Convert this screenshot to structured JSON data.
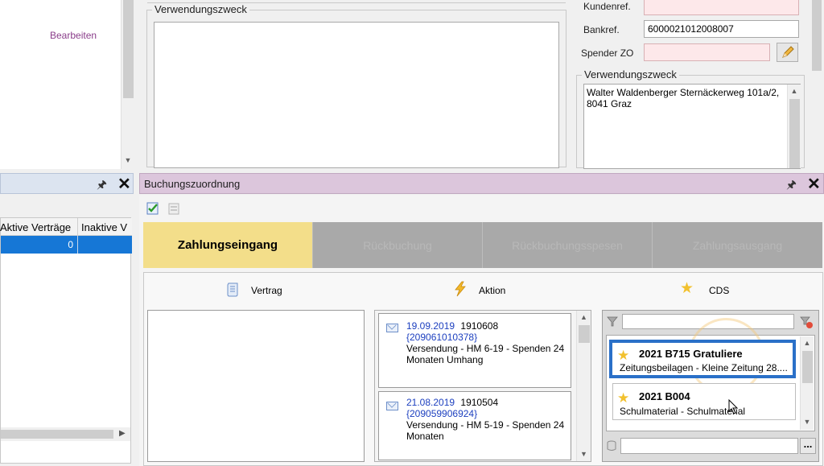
{
  "left_top": {
    "edit_link": "Bearbeiten"
  },
  "center_top": {
    "purpose_legend": "Verwendungszweck"
  },
  "right_top": {
    "customer_ref_label": "Kundenref.",
    "customer_ref_value": "",
    "bank_ref_label": "Bankref.",
    "bank_ref_value": "6000021012008007",
    "donor_label": "Spender ZO",
    "donor_value": "",
    "purpose_legend": "Verwendungszweck",
    "purpose_text_line1": "Walter Waldenberger Sternäckerweg 101a/2,",
    "purpose_text_line2": "8041 Graz"
  },
  "left_panel": {
    "columns": [
      "Aktive Verträge",
      "Inaktive V"
    ],
    "row_value": "0"
  },
  "booking_panel": {
    "title": "Buchungszuordnung",
    "tabs": [
      {
        "label": "Zahlungseingang",
        "active": true
      },
      {
        "label": "Rückbuchung",
        "active": false
      },
      {
        "label": "Rückbuchungsspesen",
        "active": false
      },
      {
        "label": "Zahlungsausgang",
        "active": false
      }
    ],
    "headers": {
      "contract": "Vertrag",
      "action": "Aktion",
      "cds": "CDS"
    },
    "actions": [
      {
        "date": "19.09.2019",
        "number": "1910608",
        "ref": "{209061010378}",
        "line1": "Versendung - HM 6-19 - Spenden 24",
        "line2": "Monaten Umhang"
      },
      {
        "date": "21.08.2019",
        "number": "1910504",
        "ref": "{209059906924}",
        "line1": "Versendung - HM 5-19 - Spenden 24",
        "line2": "Monaten"
      }
    ],
    "cds_items": [
      {
        "title": "2021 B715 Gratuliere",
        "subtitle": "Zeitungsbeilagen - Kleine Zeitung 28....",
        "selected": true
      },
      {
        "title": "2021 B004",
        "subtitle": "Schulmaterial - Schulmaterial",
        "selected": false
      }
    ],
    "cds_more_button": "..."
  },
  "colors": {
    "title_bar_pink": "#dcc6dc",
    "active_tab": "#f3de8a",
    "inactive_tab": "#a9a9a9",
    "selection_blue": "#2a70c8",
    "link_purple": "#8a3d8a"
  }
}
